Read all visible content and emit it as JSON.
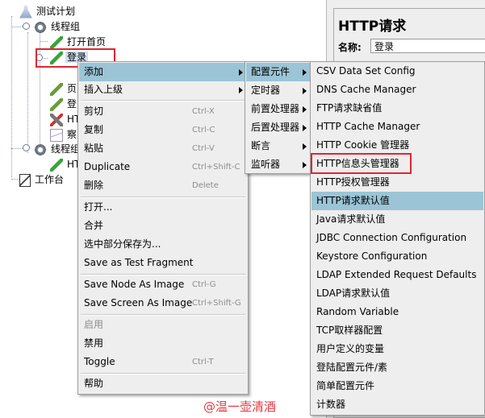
{
  "tree": {
    "root": "测试计划",
    "group1": "线程组",
    "item_open_home": "打开首页",
    "item_login": "登录",
    "item_page_partial": "页",
    "item_login_partial": "登",
    "item_http_partial": "HT",
    "item_view_partial": "察",
    "group2": "线程组",
    "item_http_partial2": "HT",
    "workbench": "工作台"
  },
  "right_panel": {
    "title": "HTTP请求",
    "name_label": "名称:",
    "name_value": "登录"
  },
  "context_menu": {
    "items": [
      {
        "label": "添加",
        "submenu": true
      },
      {
        "label": "插入上级",
        "submenu": true
      },
      {
        "label": "剪切",
        "shortcut": "Ctrl-X"
      },
      {
        "label": "复制",
        "shortcut": "Ctrl-C"
      },
      {
        "label": "粘贴",
        "shortcut": "Ctrl-V"
      },
      {
        "label": "Duplicate",
        "shortcut": "Ctrl+Shift-C"
      },
      {
        "label": "删除",
        "shortcut": "Delete"
      },
      {
        "label": "打开..."
      },
      {
        "label": "合并"
      },
      {
        "label": "选中部分保存为..."
      },
      {
        "label": "Save as Test Fragment"
      },
      {
        "label": "Save Node As Image",
        "shortcut": "Ctrl-G"
      },
      {
        "label": "Save Screen As Image",
        "shortcut": "Ctrl+Shift-G"
      },
      {
        "label": "启用"
      },
      {
        "label": "禁用"
      },
      {
        "label": "Toggle",
        "shortcut": "Ctrl-T"
      },
      {
        "label": "帮助"
      }
    ]
  },
  "add_submenu": {
    "items": [
      "配置元件",
      "定时器",
      "前置处理器",
      "后置处理器",
      "断言",
      "监听器"
    ]
  },
  "config_submenu": {
    "items": [
      "CSV Data Set Config",
      "DNS Cache Manager",
      "FTP请求缺省值",
      "HTTP Cache Manager",
      "HTTP Cookie 管理器",
      "HTTP信息头管理器",
      "HTTP授权管理器",
      "HTTP请求默认值",
      "Java请求默认值",
      "JDBC Connection Configuration",
      "Keystore Configuration",
      "LDAP Extended Request Defaults",
      "LDAP请求默认值",
      "Random Variable",
      "TCP取样器配置",
      "用户定义的变量",
      "登陆配置元件/素",
      "简单配置元件",
      "计数器"
    ]
  },
  "watermark": "@温一壶清酒",
  "colors": {
    "highlight": "#9bc5d6",
    "annotation_red": "#e0262f",
    "menu_bg": "#eeeeee"
  }
}
